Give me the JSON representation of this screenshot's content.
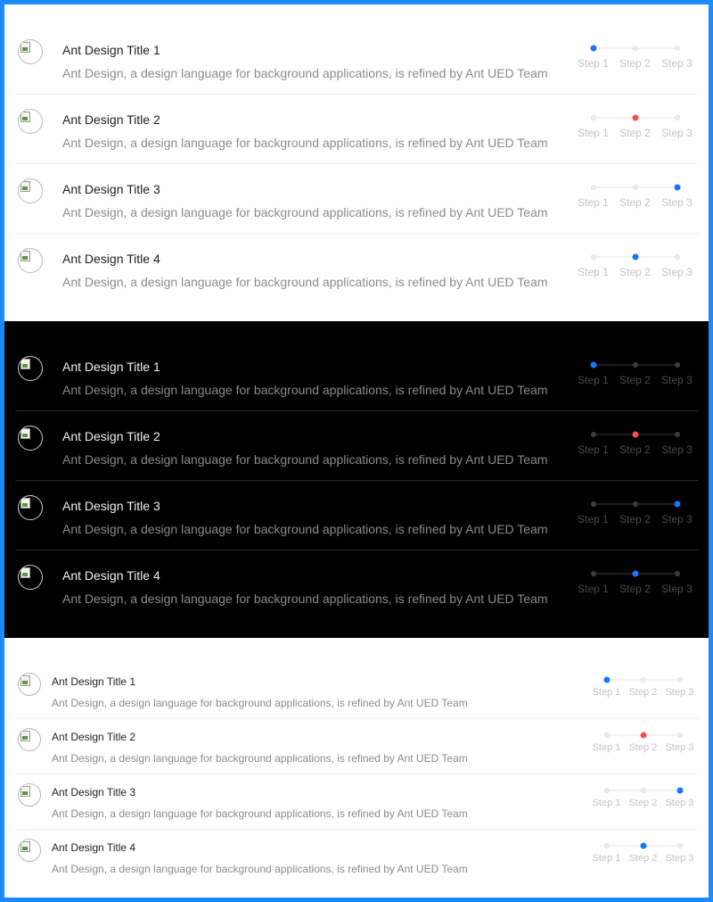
{
  "colors": {
    "primary": "#1677ff",
    "error": "#ff4d4f",
    "frame": "#1a8cff"
  },
  "sections": [
    {
      "theme": "light",
      "items": [
        {
          "title": "Ant Design Title 1",
          "description": "Ant Design, a design language for background applications, is refined by Ant UED Team",
          "current_step": 0,
          "status": "process"
        },
        {
          "title": "Ant Design Title 2",
          "description": "Ant Design, a design language for background applications, is refined by Ant UED Team",
          "current_step": 1,
          "status": "error"
        },
        {
          "title": "Ant Design Title 3",
          "description": "Ant Design, a design language for background applications, is refined by Ant UED Team",
          "current_step": 2,
          "status": "process"
        },
        {
          "title": "Ant Design Title 4",
          "description": "Ant Design, a design language for background applications, is refined by Ant UED Team",
          "current_step": 1,
          "status": "process"
        }
      ]
    },
    {
      "theme": "dark",
      "items": [
        {
          "title": "Ant Design Title 1",
          "description": "Ant Design, a design language for background applications, is refined by Ant UED Team",
          "current_step": 0,
          "status": "process"
        },
        {
          "title": "Ant Design Title 2",
          "description": "Ant Design, a design language for background applications, is refined by Ant UED Team",
          "current_step": 1,
          "status": "error"
        },
        {
          "title": "Ant Design Title 3",
          "description": "Ant Design, a design language for background applications, is refined by Ant UED Team",
          "current_step": 2,
          "status": "process"
        },
        {
          "title": "Ant Design Title 4",
          "description": "Ant Design, a design language for background applications, is refined by Ant UED Team",
          "current_step": 1,
          "status": "process"
        }
      ]
    },
    {
      "theme": "light-small",
      "items": [
        {
          "title": "Ant Design Title 1",
          "description": "Ant Design, a design language for background applications, is refined by Ant UED Team",
          "current_step": 0,
          "status": "process"
        },
        {
          "title": "Ant Design Title 2",
          "description": "Ant Design, a design language for background applications, is refined by Ant UED Team",
          "current_step": 1,
          "status": "error"
        },
        {
          "title": "Ant Design Title 3",
          "description": "Ant Design, a design language for background applications, is refined by Ant UED Team",
          "current_step": 2,
          "status": "process"
        },
        {
          "title": "Ant Design Title 4",
          "description": "Ant Design, a design language for background applications, is refined by Ant UED Team",
          "current_step": 1,
          "status": "process"
        }
      ]
    }
  ],
  "step_labels": [
    "Step 1",
    "Step 2",
    "Step 3"
  ]
}
